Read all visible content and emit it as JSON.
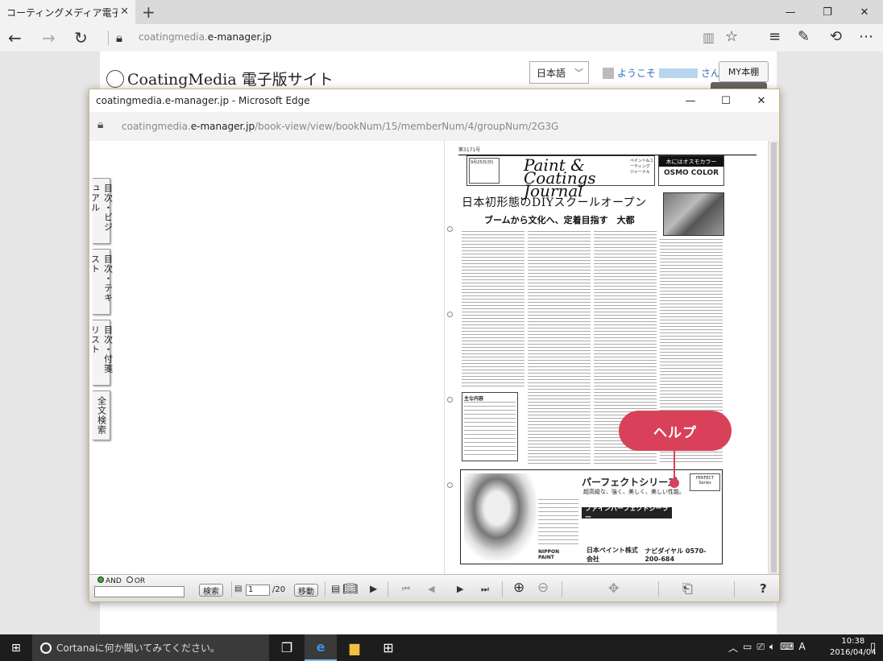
{
  "browser": {
    "tab_title": "コーティングメディア電子版サ",
    "url_host": "coatingmedia.",
    "url_domain": "e-manager.jp"
  },
  "site": {
    "logo": "CoatingMedia 電子版サイト",
    "language": "日本語",
    "welcome_prefix": "ようこそ",
    "welcome_suffix": "さん",
    "my_bookshelf": "MY本棚"
  },
  "popup": {
    "title": "coatingmedia.e-manager.jp - Microsoft Edge",
    "url_host": "coatingmedia.",
    "url_domain": "e-manager.jp",
    "url_path": "/book-view/view/bookNum/15/memberNum/4/groupNum/2G3G"
  },
  "side_tabs": [
    {
      "label": "目次・ビジュアル"
    },
    {
      "label": "目次・テキスト"
    },
    {
      "label": "目次・付箋リスト"
    },
    {
      "label": "全文検索"
    }
  ],
  "newspaper": {
    "issue_line": "第3171号",
    "masthead_left": "9月25日(日)",
    "masthead_title": "Paint & Coatings Journal",
    "masthead_sub": "ペイント&コーティング ジャーナル",
    "ad_top": "木にはオスモカラー",
    "ad_top_logo": "OSMO COLOR",
    "headline": "日本初形態のDIYスクールオープン",
    "subheadline": "ブームから文化へ、定着目指す　大都",
    "box_title": "主な内容",
    "ad_main_title": "パーフェクトシリーズ",
    "ad_main_sub": "超高級な、強く、美しく、美しい性能。",
    "ad_main_bar": "ファインパーフェクトシーラー",
    "ad_main_logo": "PERFECT Series",
    "ad_company": "日本ペイント株式会社",
    "ad_phone": "ナビダイヤル 0570-200-684",
    "ad_brand": "NIPPON PAINT"
  },
  "help": {
    "label": "ヘルプ"
  },
  "toolbar": {
    "and_label": "AND",
    "or_label": "OR",
    "search_button": "検索",
    "page_value": "1",
    "page_total": "/20",
    "move_button": "移動"
  },
  "taskbar": {
    "search_placeholder": "Cortanaに何か聞いてみてください。",
    "time": "10:38",
    "date": "2016/04/04",
    "ime": "A"
  }
}
